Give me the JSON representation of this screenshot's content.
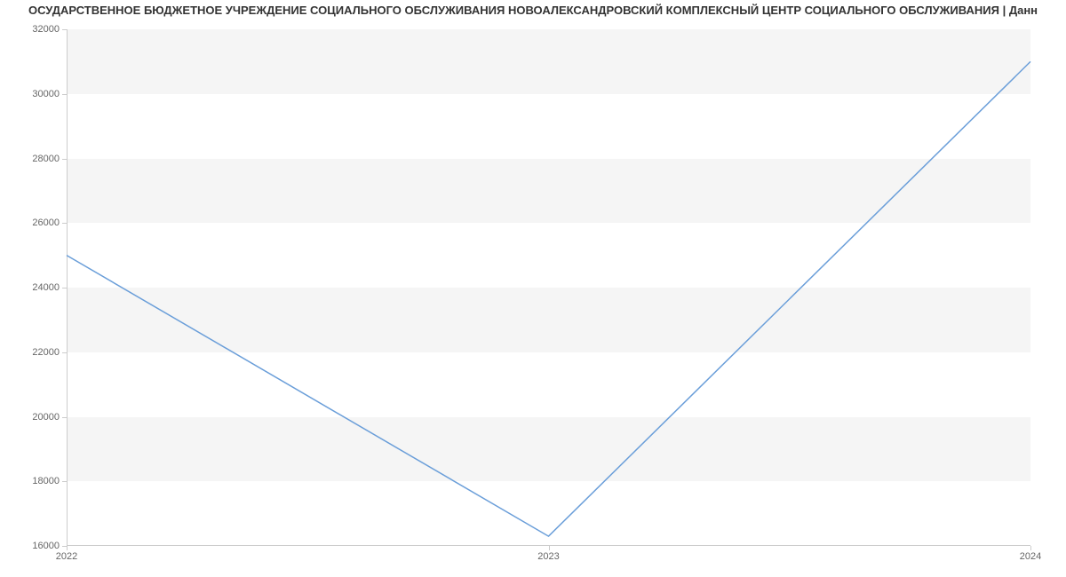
{
  "chart_data": {
    "type": "line",
    "title": "ОСУДАРСТВЕННОЕ БЮДЖЕТНОЕ УЧРЕЖДЕНИЕ СОЦИАЛЬНОГО ОБСЛУЖИВАНИЯ НОВОАЛЕКСАНДРОВСКИЙ КОМПЛЕКСНЫЙ ЦЕНТР СОЦИАЛЬНОГО ОБСЛУЖИВАНИЯ | Данн",
    "x": [
      2022,
      2023,
      2024
    ],
    "values": [
      25000,
      16300,
      31000
    ],
    "xlabel": "",
    "ylabel": "",
    "xlim": [
      2022,
      2024
    ],
    "ylim": [
      16000,
      32000
    ],
    "y_ticks": [
      16000,
      18000,
      20000,
      22000,
      24000,
      26000,
      28000,
      30000,
      32000
    ],
    "x_ticks": [
      2022,
      2023,
      2024
    ],
    "line_color": "#6a9ed9",
    "band_color": "#f5f5f5"
  }
}
